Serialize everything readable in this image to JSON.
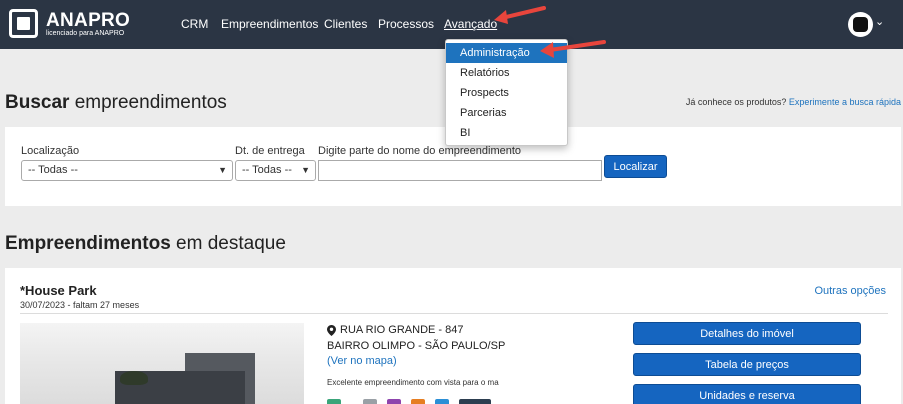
{
  "brand": {
    "name": "ANAPRO",
    "tagline": "licenciado para ANAPRO"
  },
  "nav": {
    "items": [
      "CRM",
      "Empreendimentos",
      "Clientes",
      "Processos",
      "Avançado"
    ],
    "active": "Avançado"
  },
  "dropdown": {
    "items": [
      "Administração",
      "Relatórios",
      "Prospects",
      "Parcerias",
      "BI"
    ],
    "highlighted": "Administração"
  },
  "search": {
    "title_bold": "Buscar",
    "title_rest": " empreendimentos",
    "hint_text": "Já conhece os produtos? ",
    "hint_link": "Experimente a busca rápida",
    "location_label": "Localização",
    "location_value": "-- Todas --",
    "delivery_label": "Dt. de entrega",
    "delivery_value": "-- Todas --",
    "name_label": "Digite parte do nome do empreendimento",
    "name_value": "",
    "submit_label": "Localizar"
  },
  "featured": {
    "title_bold": "Empreendimentos",
    "title_rest": " em destaque",
    "property": {
      "name": "*House Park",
      "date": "30/07/2023 - faltam 27 meses",
      "other_options": "Outras opções",
      "address_line1": "RUA RIO GRANDE - 847",
      "address_line2": "BAIRRO OLIMPO - SÃO PAULO/SP",
      "map_link": "(Ver no mapa)",
      "description": "Excelente empreendimento com vista para o ma",
      "tag_colors": [
        "#3aa57a",
        "#9aa0a6",
        "#8e44ad",
        "#e67e22",
        "#2b8fd6",
        "#2c3e50"
      ],
      "actions": [
        "Detalhes do imóvel",
        "Tabela de preços",
        "Unidades e reserva"
      ]
    }
  },
  "colors": {
    "topbar": "#2b3544",
    "accent": "#1e73be",
    "button": "#1565c0",
    "arrow": "#e8453c"
  }
}
